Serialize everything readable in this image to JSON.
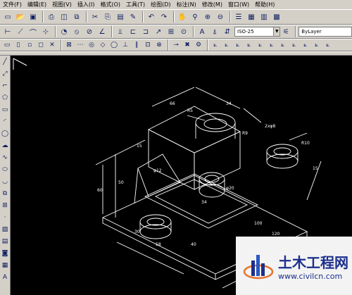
{
  "menu": [
    "文件(F)",
    "编辑(E)",
    "视图(V)",
    "插入(I)",
    "格式(O)",
    "工具(T)",
    "绘图(D)",
    "标注(N)",
    "修改(M)",
    "窗口(W)",
    "帮助(H)"
  ],
  "toolbar": {
    "dimstyle_value": "ISO-25",
    "layer_value": "ByLayer"
  },
  "dimensions": [
    "66",
    "34",
    "R9",
    "R5",
    "2xφ8",
    "R10",
    "15",
    "50",
    "60",
    "34",
    "100",
    "120",
    "30",
    "58",
    "15",
    "φ20",
    "φ12",
    "40"
  ],
  "watermark": {
    "name": "土木工程网",
    "url": "www.civilcn.com"
  },
  "colors": {
    "toolbar_bg": "#d4d0c8",
    "canvas_bg": "#000000",
    "drawing_lines": "#ffffff",
    "brand": "#1c2f8c"
  }
}
